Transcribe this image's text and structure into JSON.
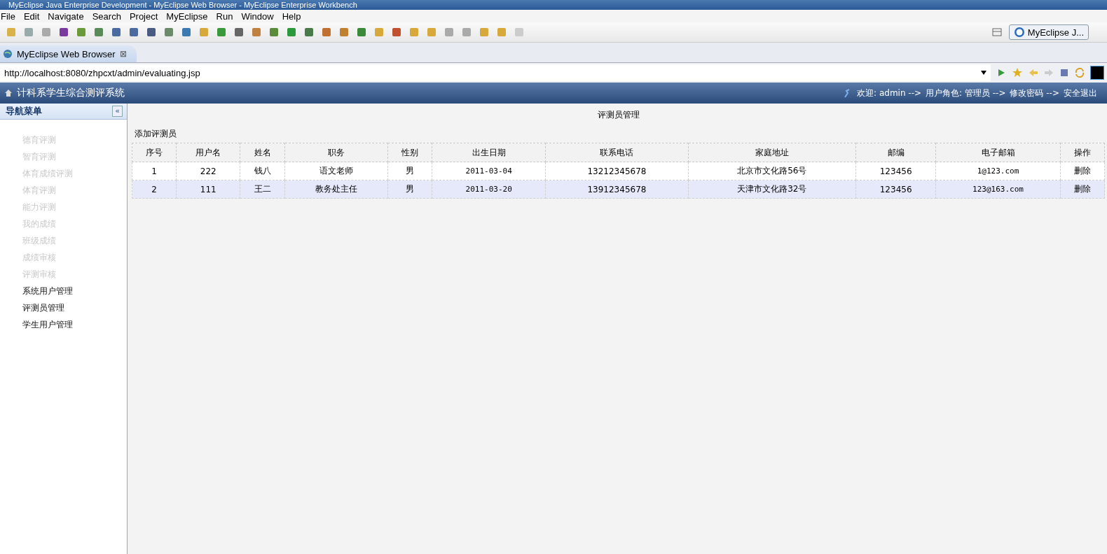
{
  "window": {
    "title": "MyEclipse Java Enterprise Development - MyEclipse Web Browser - MyEclipse Enterprise Workbench"
  },
  "menu": [
    "File",
    "Edit",
    "Navigate",
    "Search",
    "Project",
    "MyEclipse",
    "Run",
    "Window",
    "Help"
  ],
  "perspective": {
    "label": "MyEclipse J..."
  },
  "editor_tab": {
    "label": "MyEclipse Web Browser",
    "close": "⊠"
  },
  "address": {
    "value": "http://localhost:8080/zhpcxt/admin/evaluating.jsp"
  },
  "app": {
    "title": "计科系学生综合测评系统",
    "header_links": [
      "欢迎: admin -->",
      "用户角色: 管理员 -->",
      "修改密码 -->",
      "安全退出"
    ],
    "sidebar": {
      "title": "导航菜单",
      "collapse": "«",
      "items": [
        {
          "label": "德育评测",
          "disabled": true
        },
        {
          "label": "智育评测",
          "disabled": true
        },
        {
          "label": "体育成绩评测",
          "disabled": true
        },
        {
          "label": "体育评测",
          "disabled": true
        },
        {
          "label": "能力评测",
          "disabled": true
        },
        {
          "label": "我的成绩",
          "disabled": true
        },
        {
          "label": "班级成绩",
          "disabled": true
        },
        {
          "label": "成绩审核",
          "disabled": true
        },
        {
          "label": "评测审核",
          "disabled": true
        },
        {
          "label": "系统用户管理",
          "disabled": false
        },
        {
          "label": "评测员管理",
          "disabled": false
        },
        {
          "label": "学生用户管理",
          "disabled": false
        }
      ]
    },
    "page_title": "评测员管理",
    "add_link": "添加评测员",
    "table": {
      "columns": [
        "序号",
        "用户名",
        "姓名",
        "职务",
        "性别",
        "出生日期",
        "联系电话",
        "家庭地址",
        "邮编",
        "电子邮箱",
        "操作"
      ],
      "rows": [
        {
          "selected": false,
          "cells": [
            "1",
            "222",
            "钱八",
            "语文老师",
            "男",
            "2011-03-04",
            "13212345678",
            "北京市文化路56号",
            "123456",
            "1@123.com"
          ],
          "action": "删除"
        },
        {
          "selected": true,
          "cells": [
            "2",
            "111",
            "王二",
            "教务处主任",
            "男",
            "2011-03-20",
            "13912345678",
            "天津市文化路32号",
            "123456",
            "123@163.com"
          ],
          "action": "删除"
        }
      ]
    }
  }
}
